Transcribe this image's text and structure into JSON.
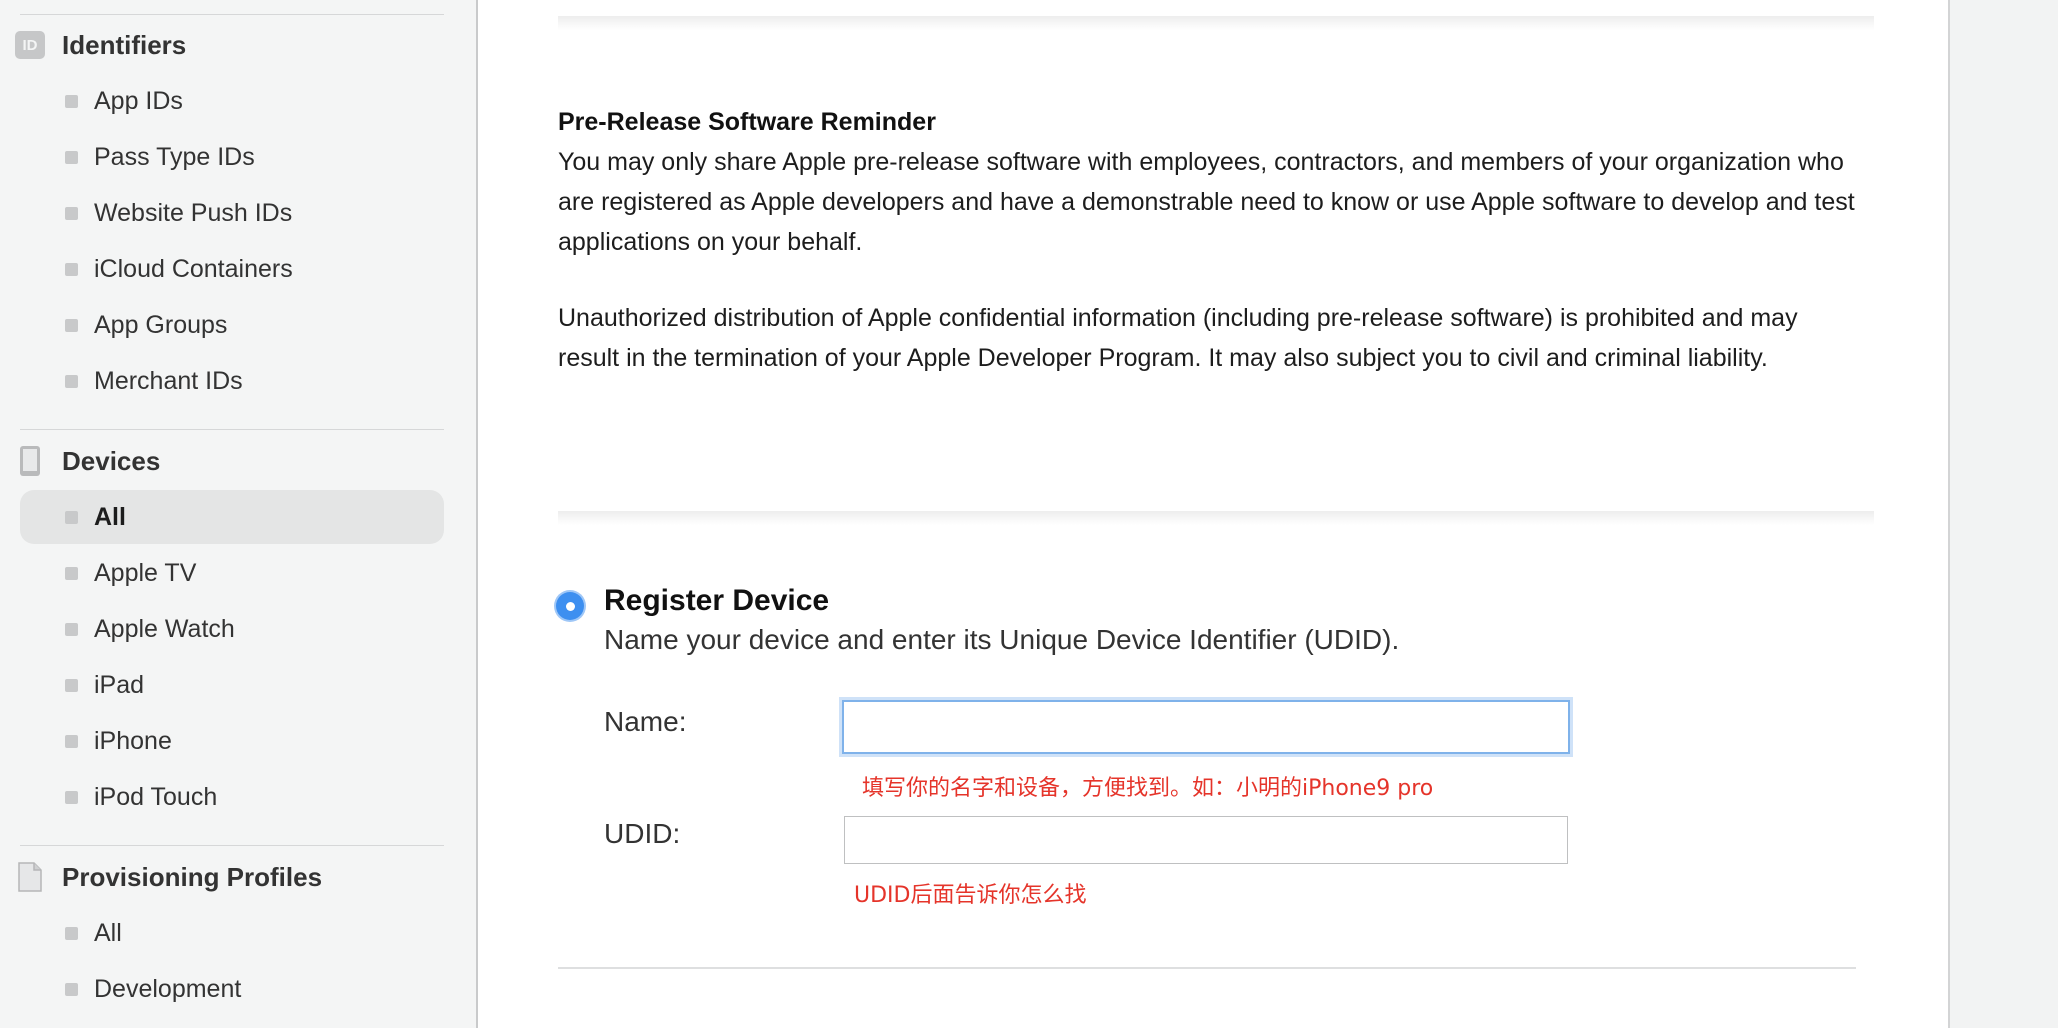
{
  "sidebar": {
    "identifiers": {
      "title": "Identifiers",
      "icon_text": "ID",
      "items": [
        "App IDs",
        "Pass Type IDs",
        "Website Push IDs",
        "iCloud Containers",
        "App Groups",
        "Merchant IDs"
      ]
    },
    "devices": {
      "title": "Devices",
      "items": [
        "All",
        "Apple TV",
        "Apple Watch",
        "iPad",
        "iPhone",
        "iPod Touch"
      ],
      "active_item": "All"
    },
    "profiles": {
      "title": "Provisioning Profiles",
      "items": [
        "All",
        "Development"
      ]
    }
  },
  "main": {
    "reminder_title": "Pre-Release Software Reminder",
    "reminder_p1": "You may only share Apple pre-release software with employees, contractors, and members of your organization who are registered as Apple developers and have a demonstrable need to know or use Apple software to develop and test applications on your behalf.",
    "reminder_p2": "Unauthorized distribution of Apple confidential information (including pre-release software) is prohibited and may result in the termination of your Apple Developer Program. It may also subject you to civil and criminal liability.",
    "register": {
      "title": "Register Device",
      "subtitle": "Name your device and enter its Unique Device Identifier (UDID).",
      "name_label": "Name:",
      "name_value": "",
      "name_hint": "填写你的名字和设备，方便找到。如：小明的iPhone9 pro",
      "udid_label": "UDID:",
      "udid_value": "",
      "udid_hint": "UDID后面告诉你怎么找"
    }
  },
  "colors": {
    "accent": "#3d8ff0",
    "hint_red": "#e5342a",
    "sidebar_bg": "#f4f5f5",
    "active_bg": "#e4e5e5"
  }
}
